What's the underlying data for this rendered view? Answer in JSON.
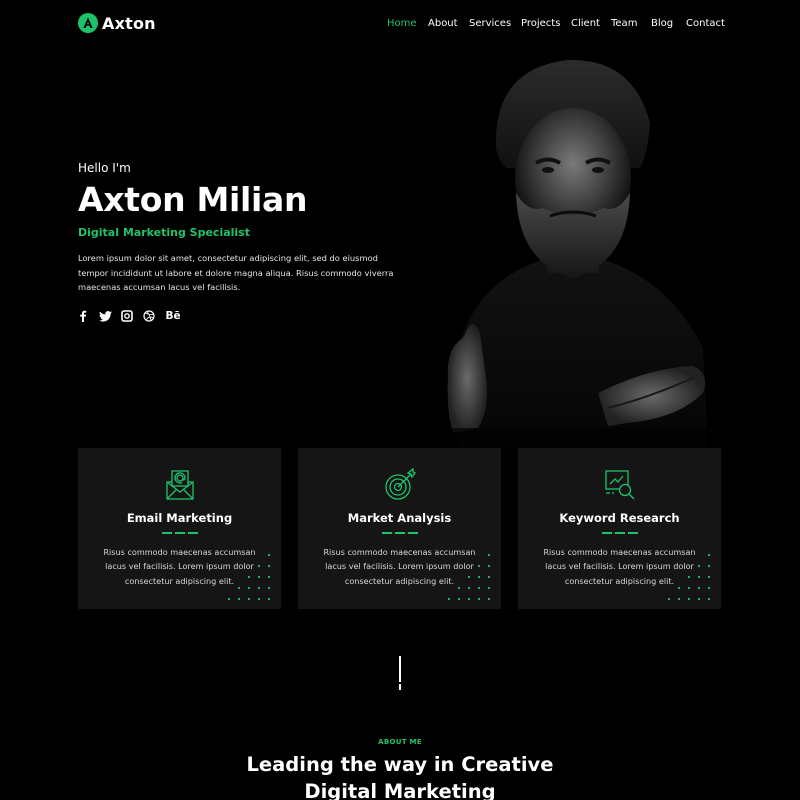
{
  "brand": {
    "mark": "A",
    "name": "Axton",
    "accent": "#1fc36b"
  },
  "nav": {
    "items": [
      {
        "label": "Home",
        "active": true
      },
      {
        "label": "About"
      },
      {
        "label": "Services"
      },
      {
        "label": "Projects"
      },
      {
        "label": "Client"
      },
      {
        "label": "Team"
      },
      {
        "label": "Blog"
      },
      {
        "label": "Contact"
      }
    ]
  },
  "hero": {
    "greeting": "Hello I'm",
    "name": "Axton Milian",
    "role": "Digital Marketing Specialist",
    "bio": "Lorem ipsum dolor sit amet, consectetur adipiscing elit, sed do eiusmod tempor incididunt ut labore et dolore magna aliqua. Risus commodo viverra maecenas accumsan lacus vel facilisis.",
    "socials": [
      "facebook-icon",
      "twitter-icon",
      "instagram-icon",
      "dribbble-icon",
      "behance-icon"
    ],
    "behance_label": "Bē"
  },
  "services": [
    {
      "title": "Email Marketing",
      "icon": "email-marketing-icon",
      "text": "Risus commodo maecenas accumsan lacus vel facilisis. Lorem ipsum dolor consectetur adipiscing elit."
    },
    {
      "title": "Market Analysis",
      "icon": "target-icon",
      "text": "Risus commodo maecenas accumsan lacus vel facilisis. Lorem ipsum dolor consectetur adipiscing elit."
    },
    {
      "title": "Keyword Research",
      "icon": "keyword-research-icon",
      "text": "Risus commodo maecenas accumsan lacus vel facilisis. Lorem ipsum dolor consectetur adipiscing elit."
    }
  ],
  "about": {
    "tag": "ABOUT ME",
    "title_line1": "Leading the way in Creative",
    "title_line2": "Digital Marketing"
  }
}
